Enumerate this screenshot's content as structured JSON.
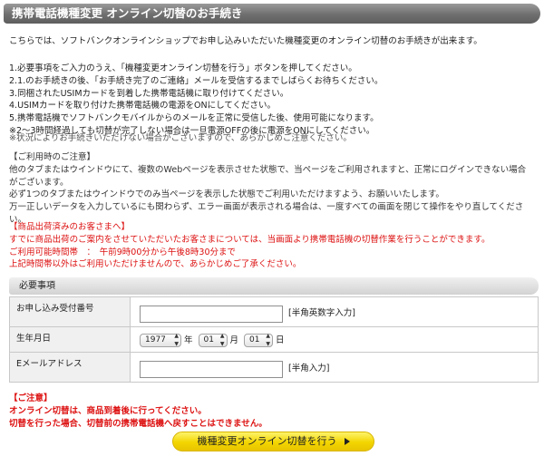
{
  "title": "携帯電話機種変更 オンライン切替のお手続き",
  "intro": "こちらでは、ソフトバンクオンラインショップでお申し込みいただいた機種変更のオンライン切替のお手続きが出来ます。",
  "steps": [
    "1.必要事項をご入力のうえ、「機種変更オンライン切替を行う」ボタンを押してください。",
    "2.1.のお手続きの後、「お手続き完了のご連絡」メールを受信するまでしばらくお待ちください。",
    "3.同梱されたUSIMカードを到着した携帯電話機に取り付けてください。",
    "4.USIMカードを取り付けた携帯電話機の電源をONにしてください。",
    "5.携帯電話機でソフトバンクモバイルからのメールを正常に受信した後、使用可能になります。",
    "※2～3時間経過しても切替が完了しない場合は一旦電源OFFの後に電源をONにしてください。"
  ],
  "notice": "※状況によりお手続きいただけない場合がございますので、あらかじめご注意ください。",
  "usage": {
    "heading": "【ご利用時のご注意】",
    "lines": [
      "他のタブまたはウインドウにて、複数のWebページを表示させた状態で、当ページをご利用されますと、正常にログインできない場合",
      "がございます。",
      "必ず1つのタブまたはウインドウでのみ当ページを表示した状態でご利用いただけますよう、お願いいたします。",
      "万一正しいデータを入力しているにも関わらず、エラー画面が表示される場合は、一度すべての画面を閉じて操作をやり直してくださ",
      "い。"
    ]
  },
  "shipped": {
    "heading": "【商品出荷済みのお客さまへ】",
    "lines": [
      "すでに商品出荷のご案内をさせていただいたお客さまについては、当画面より携帯電話機の切替作業を行うことができます。",
      "ご利用可能時間帯　：　午前9時00分から午後8時30分まで",
      "上記時間帯以外はご利用いただけませんので、あらかじめご了承ください。"
    ]
  },
  "form": {
    "section_title": "必要事項",
    "order_number_label": "お申し込み受付番号",
    "order_number_value": "",
    "order_number_hint": "[半角英数字入力]",
    "birth_label": "生年月日",
    "birth_year": "1977",
    "year_unit": "年",
    "birth_month": "01",
    "month_unit": "月",
    "birth_day": "01",
    "day_unit": "日",
    "email_label": "Eメールアドレス",
    "email_value": "",
    "email_hint": "[半角入力]"
  },
  "caution": {
    "heading": "【ご注意】",
    "lines": [
      "オンライン切替は、商品到着後に行ってください。",
      "切替を行った場合、切替前の携帯電話機へ戻すことはできません。"
    ]
  },
  "submit_label": "機種変更オンライン切替を行う"
}
